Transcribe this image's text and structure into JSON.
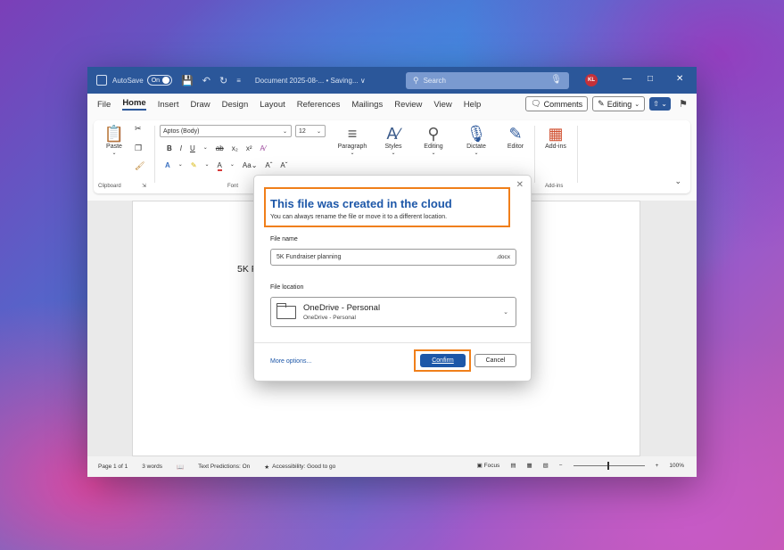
{
  "titlebar": {
    "autosave_label": "AutoSave",
    "autosave_state": "On",
    "doc_title": "Document 2025-08-... • Saving... ∨",
    "search_placeholder": "Search",
    "avatar_initials": "KL"
  },
  "menu": {
    "items": [
      "File",
      "Home",
      "Insert",
      "Draw",
      "Design",
      "Layout",
      "References",
      "Mailings",
      "Review",
      "View",
      "Help"
    ],
    "active": "Home",
    "comments_label": "Comments",
    "editing_label": "Editing"
  },
  "ribbon": {
    "paste_label": "Paste",
    "font_name": "Aptos (Body)",
    "font_size": "12",
    "clipboard_label": "Clipboard",
    "font_group_label": "Font",
    "paragraph_label": "Paragraph",
    "styles_label": "Styles",
    "editing_label": "Editing",
    "dictate_label": "Dictate",
    "editor_label": "Editor",
    "addins_label": "Add-ins",
    "addins_group_label": "Add-ins"
  },
  "document": {
    "visible_text": "5K Fundraiser"
  },
  "dialog": {
    "title": "This file was created in the cloud",
    "subtitle": "You can always rename the file or move it to a different location.",
    "file_name_label": "File name",
    "file_name_value": "5K Fundraiser planning",
    "file_ext": ".docx",
    "file_location_label": "File location",
    "location_main": "OneDrive - Personal",
    "location_sub": "OneDrive - Personal",
    "more_options": "More options...",
    "confirm": "Confirm",
    "cancel": "Cancel"
  },
  "statusbar": {
    "page": "Page 1 of 1",
    "words": "3 words",
    "text_predictions": "Text Predictions: On",
    "accessibility": "Accessibility: Good to go",
    "focus": "Focus",
    "zoom": "100%"
  },
  "colors": {
    "title_bar": "#2b579a",
    "accent": "#1d57a8",
    "highlight": "#f07f1a"
  }
}
